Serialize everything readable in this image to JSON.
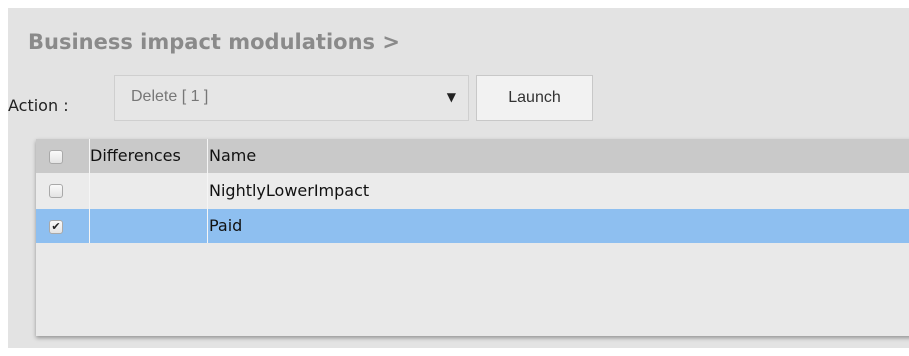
{
  "page": {
    "title": "Business impact modulations >"
  },
  "action": {
    "label": "Action :",
    "selected": "Delete [ 1 ]",
    "arrow_icon": "dropdown-arrow-icon",
    "launch_label": "Launch"
  },
  "table": {
    "columns": [
      "",
      "Differences",
      "Name"
    ],
    "rows": [
      {
        "checked": false,
        "differences": "",
        "name": "NightlyLowerImpact"
      },
      {
        "checked": true,
        "differences": "",
        "name": "Paid"
      }
    ]
  },
  "colors": {
    "panel": "#e3e3e3",
    "header": "#c9c9c9",
    "selected_row": "#8ebff0",
    "title": "#8a8a8a"
  }
}
